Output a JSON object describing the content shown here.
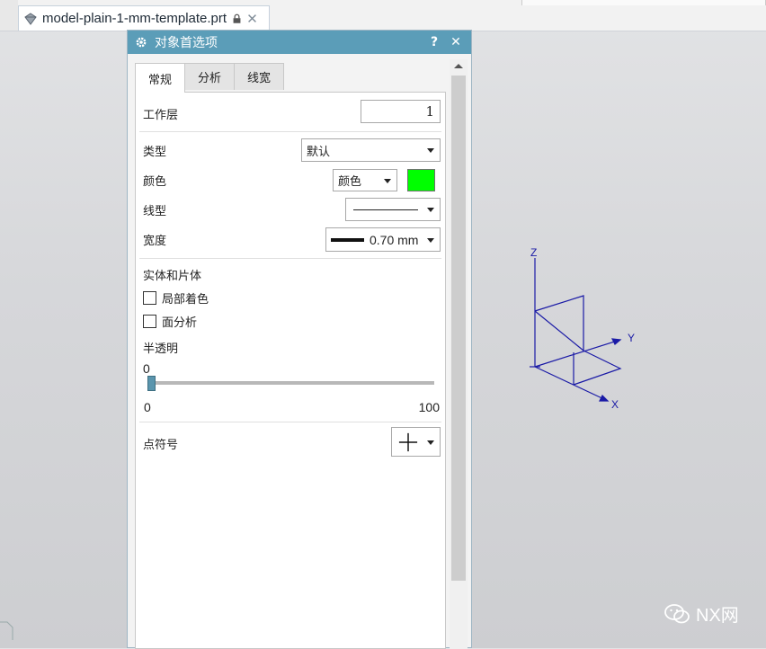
{
  "tab_strip": {
    "document_tab": "model-plain-1-mm-template.prt"
  },
  "dialog": {
    "title": "对象首选项",
    "help_label": "?",
    "close_label": "✕",
    "tabs": [
      "常规",
      "分析",
      "线宽"
    ],
    "active_tab": "常规",
    "fields": {
      "work_layer_label": "工作层",
      "work_layer_value": "1",
      "type_label": "类型",
      "type_value": "默认",
      "color_label": "颜色",
      "color_dropdown_value": "颜色",
      "color_swatch": "#00ff00",
      "linetype_label": "线型",
      "width_label": "宽度",
      "width_value": "0.70 mm"
    },
    "solids_section": {
      "title": "实体和片体",
      "partial_shading_label": "局部着色",
      "partial_shading_checked": false,
      "face_analysis_label": "面分析",
      "face_analysis_checked": false
    },
    "translucency": {
      "label": "半透明",
      "current_value": "0",
      "min_label": "0",
      "max_label": "100",
      "level": 0
    },
    "point_symbol": {
      "label": "点符号"
    }
  },
  "viewport": {
    "axes": {
      "z": "Z",
      "y": "Y",
      "x": "X"
    },
    "axis_color": "#1a1aa6",
    "annotation_arrow_color": "#e83428"
  },
  "watermark": {
    "text": "NX网"
  }
}
